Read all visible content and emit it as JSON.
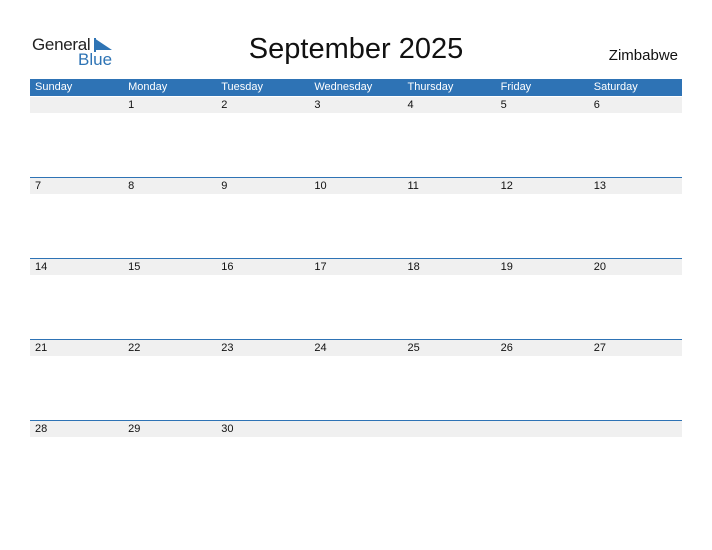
{
  "logo": {
    "line1": "General",
    "line2": "Blue"
  },
  "title": "September 2025",
  "country": "Zimbabwe",
  "colors": {
    "accent": "#2e73b5",
    "band": "#f0f0f0"
  },
  "weekdays": [
    "Sunday",
    "Monday",
    "Tuesday",
    "Wednesday",
    "Thursday",
    "Friday",
    "Saturday"
  ],
  "weeks": [
    [
      "",
      "1",
      "2",
      "3",
      "4",
      "5",
      "6"
    ],
    [
      "7",
      "8",
      "9",
      "10",
      "11",
      "12",
      "13"
    ],
    [
      "14",
      "15",
      "16",
      "17",
      "18",
      "19",
      "20"
    ],
    [
      "21",
      "22",
      "23",
      "24",
      "25",
      "26",
      "27"
    ],
    [
      "28",
      "29",
      "30",
      "",
      "",
      "",
      ""
    ]
  ]
}
